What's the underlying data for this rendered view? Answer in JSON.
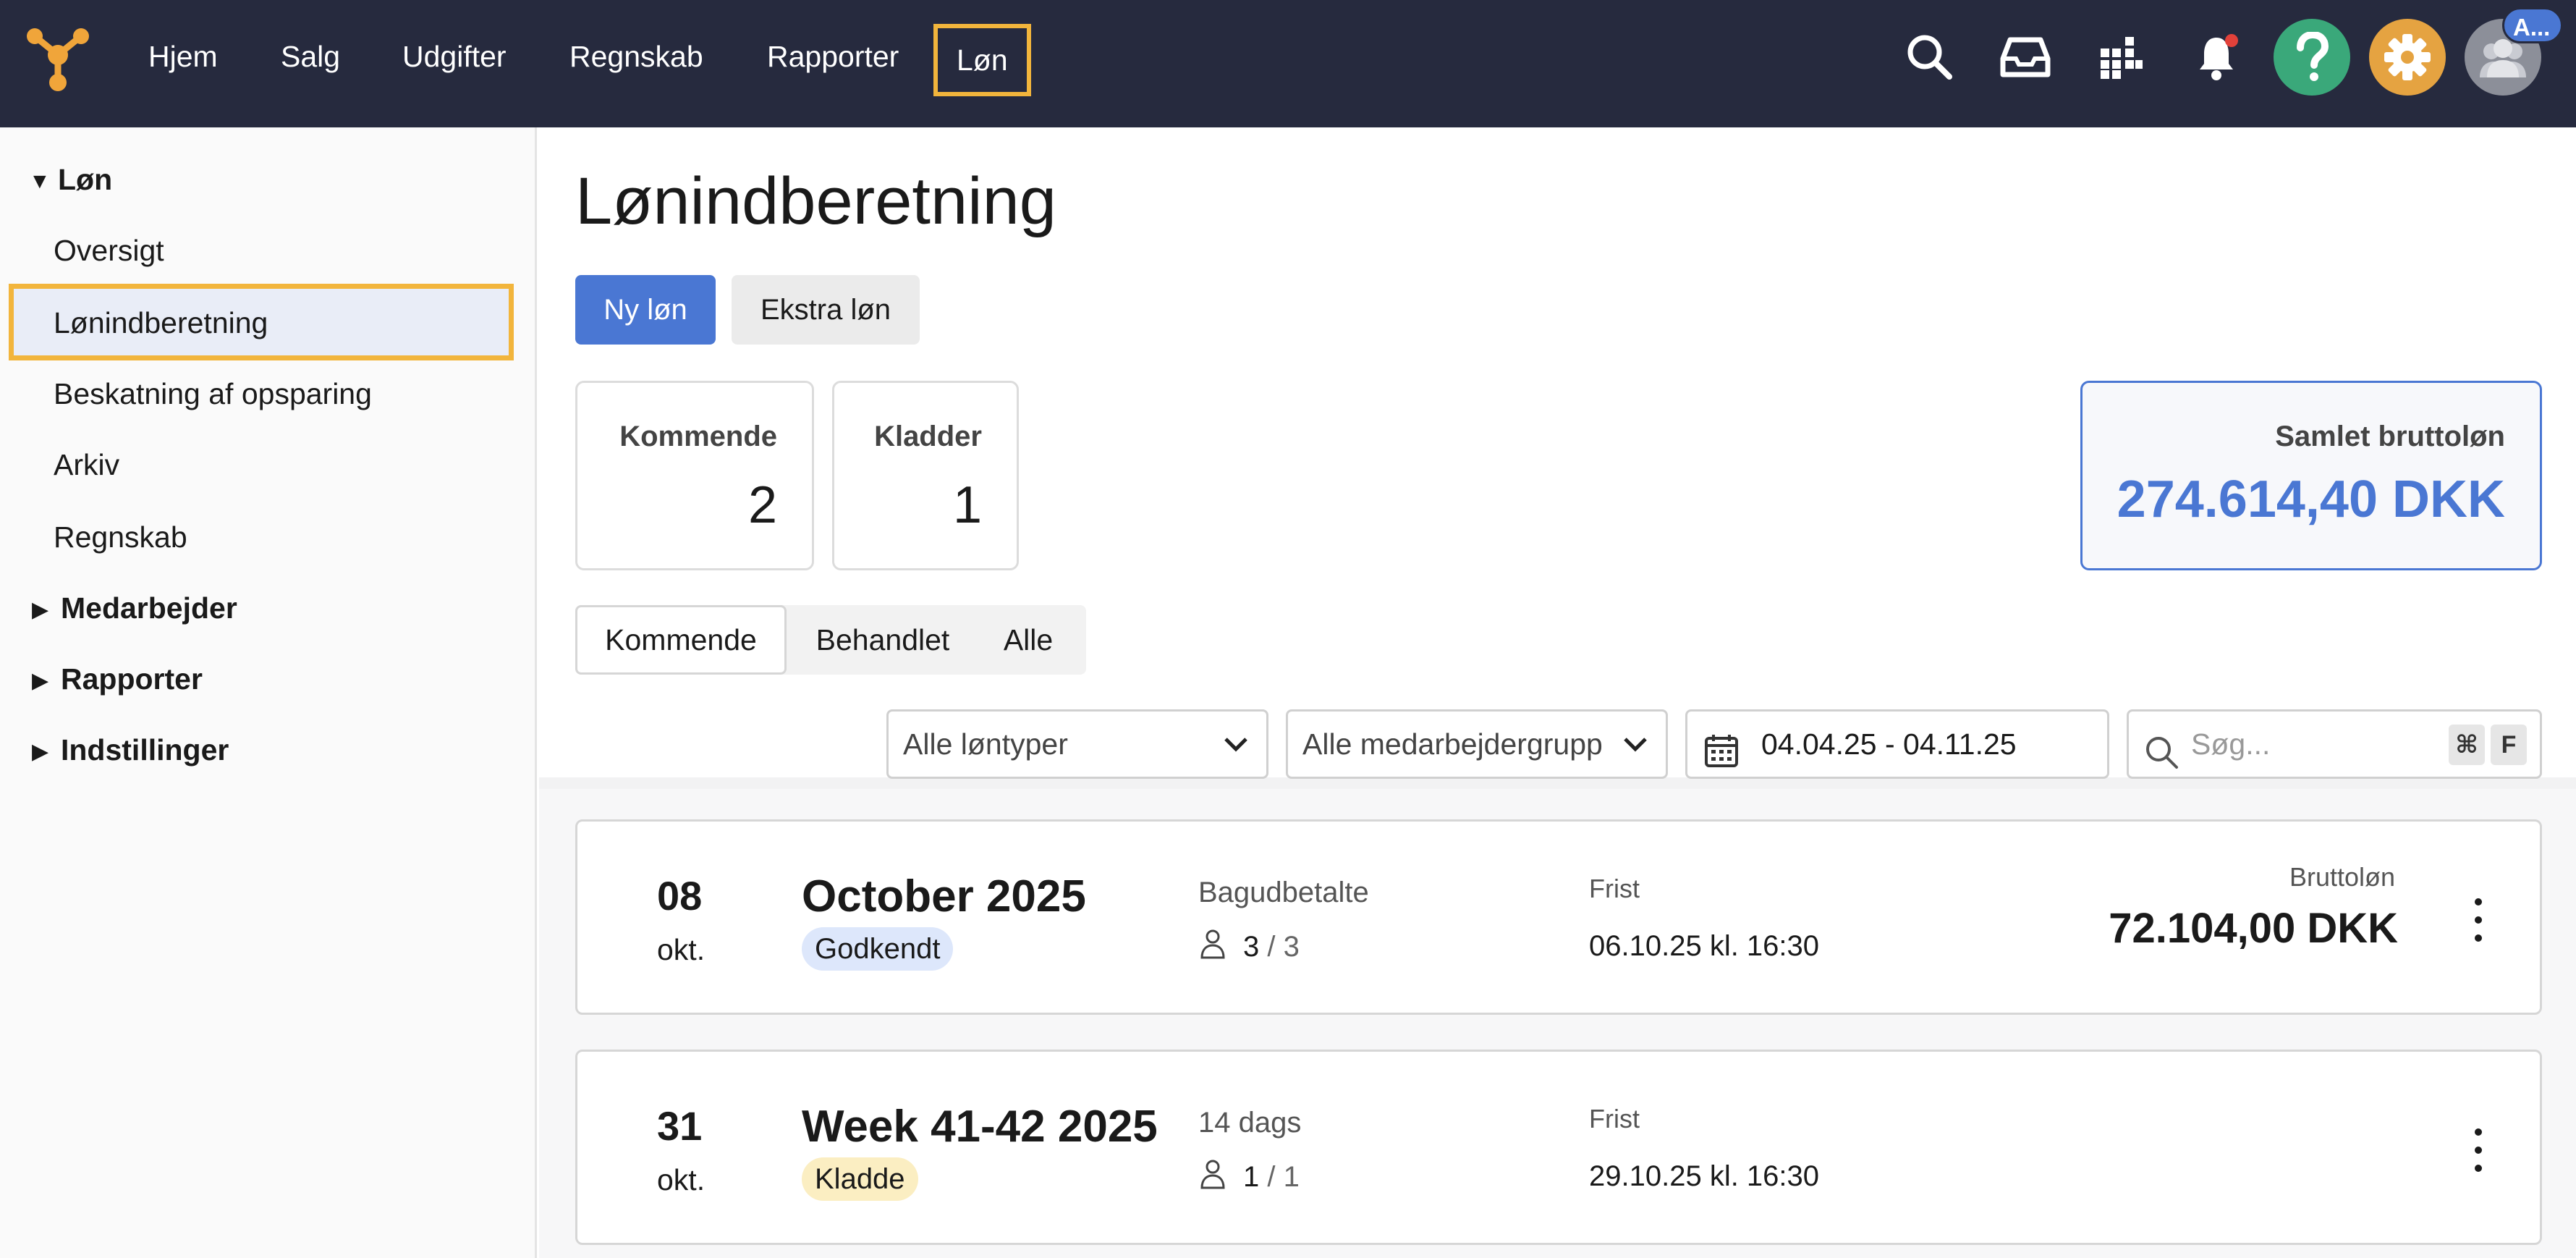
{
  "nav": {
    "items": [
      {
        "label": "Hjem"
      },
      {
        "label": "Salg"
      },
      {
        "label": "Udgifter"
      },
      {
        "label": "Regnskab"
      },
      {
        "label": "Rapporter"
      },
      {
        "label": "Løn"
      }
    ],
    "active": "Løn",
    "avatar_badge": "A...",
    "colors": {
      "bar": "#262a3e",
      "highlight": "#f2b53c",
      "help": "#3aa87a",
      "settings": "#e5a341",
      "accent": "#4a77d3"
    },
    "icons": [
      "search-icon",
      "inbox-icon",
      "apps-grid-icon",
      "bell-icon",
      "help-icon",
      "gear-icon",
      "avatar-icon"
    ]
  },
  "sidebar": {
    "section": "Løn",
    "items": [
      {
        "label": "Oversigt"
      },
      {
        "label": "Lønindberetning"
      },
      {
        "label": "Beskatning af opsparing"
      },
      {
        "label": "Arkiv"
      },
      {
        "label": "Regnskab"
      }
    ],
    "groups": [
      {
        "label": "Medarbejder"
      },
      {
        "label": "Rapporter"
      },
      {
        "label": "Indstillinger"
      }
    ]
  },
  "page": {
    "title": "Lønindberetning",
    "new_button": "Ny løn",
    "extra_button": "Ekstra løn"
  },
  "stats": {
    "upcoming": {
      "label": "Kommende",
      "value": "2"
    },
    "drafts": {
      "label": "Kladder",
      "value": "1"
    },
    "total": {
      "label": "Samlet bruttoløn",
      "value": "274.614,40 DKK"
    }
  },
  "tabs": [
    {
      "label": "Kommende",
      "active": true
    },
    {
      "label": "Behandlet"
    },
    {
      "label": "Alle"
    }
  ],
  "filters": {
    "pay_types": "Alle løntyper",
    "employee_groups": "Alle medarbejdergrupp",
    "date_range": "04.04.25 - 04.11.25",
    "search_placeholder": "Søg...",
    "shortcut_cmd": "⌘",
    "shortcut_key": "F"
  },
  "payruns": [
    {
      "day": "08",
      "month": "okt.",
      "period": "October 2025",
      "status": "Godkendt",
      "pay_type": "Bagudbetalte",
      "employees_done": "3",
      "employees_total": "/ 3",
      "deadline_label": "Frist",
      "deadline": "06.10.25 kl. 16:30",
      "gross_label": "Bruttoløn",
      "gross": "72.104,00 DKK"
    },
    {
      "day": "31",
      "month": "okt.",
      "period": "Week 41-42 2025",
      "status": "Kladde",
      "pay_type": "14 dags",
      "employees_done": "1",
      "employees_total": "/ 1",
      "deadline_label": "Frist",
      "deadline": "29.10.25 kl. 16:30"
    }
  ]
}
